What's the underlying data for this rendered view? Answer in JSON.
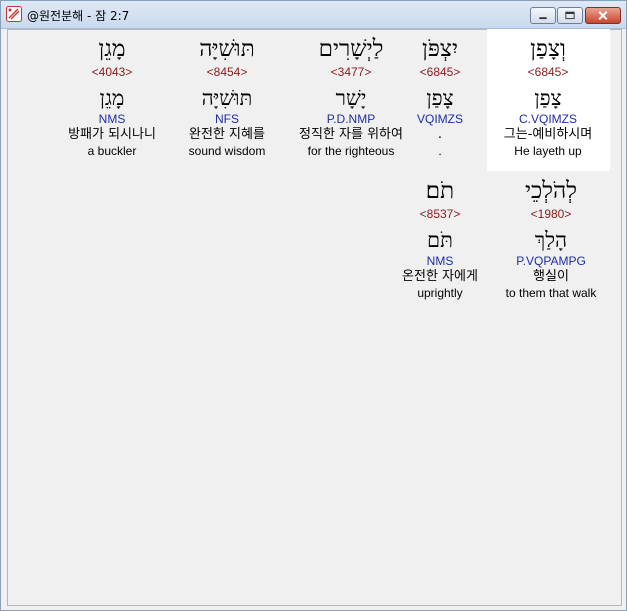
{
  "window": {
    "title": "@원전분해 - 잠 2:7",
    "buttons": {
      "minimize": "minimize-icon",
      "maximize": "maximize-icon",
      "close": "close-icon"
    }
  },
  "row1": [
    {
      "hebrew": "וְצָפַן",
      "strong": "<6845>",
      "root": "צָפַן",
      "parse": "C.VQIMZS",
      "korean": "그는-예비하시며",
      "english": "He layeth up"
    },
    {
      "hebrew": "יִצְפֹּן",
      "strong": "<6845>",
      "root": "צָפַן",
      "parse": "VQIMZS",
      "korean": ".",
      "english": "."
    },
    {
      "hebrew": "לַיְשָׁרִים",
      "strong": "<3477>",
      "root": "יָשָׁר",
      "parse": "P.D.NMP",
      "korean": "정직한 자를 위하여",
      "english": "for the righteous"
    },
    {
      "hebrew": "תּוּשִׁיָּה",
      "strong": "<8454>",
      "root": "תּוּשִׁיָּה",
      "parse": "NFS",
      "korean": "완전한 지혜를",
      "english": "sound wisdom"
    },
    {
      "hebrew": "מָגֵן",
      "strong": "<4043>",
      "root": "מָגֵן",
      "parse": "NMS",
      "korean": "방패가 되시나니",
      "english": "a buckler"
    }
  ],
  "row2": [
    {
      "hebrew": "לְהֹלְכֵי",
      "strong": "<1980>",
      "root": "הָלַךְ",
      "parse": "P.VQPAMPG",
      "korean": "행실이",
      "english": "to them that walk"
    },
    {
      "hebrew": "תֹם׃",
      "strong": "<8537>",
      "root": "תֹּם",
      "parse": "NMS",
      "korean": "온전한 자에게",
      "english": "uprightly"
    }
  ],
  "colors": {
    "strong": "#8b1a1a",
    "parse": "#1c2ea6",
    "highlight": "#ffffff",
    "background": "#f0f0f0"
  }
}
